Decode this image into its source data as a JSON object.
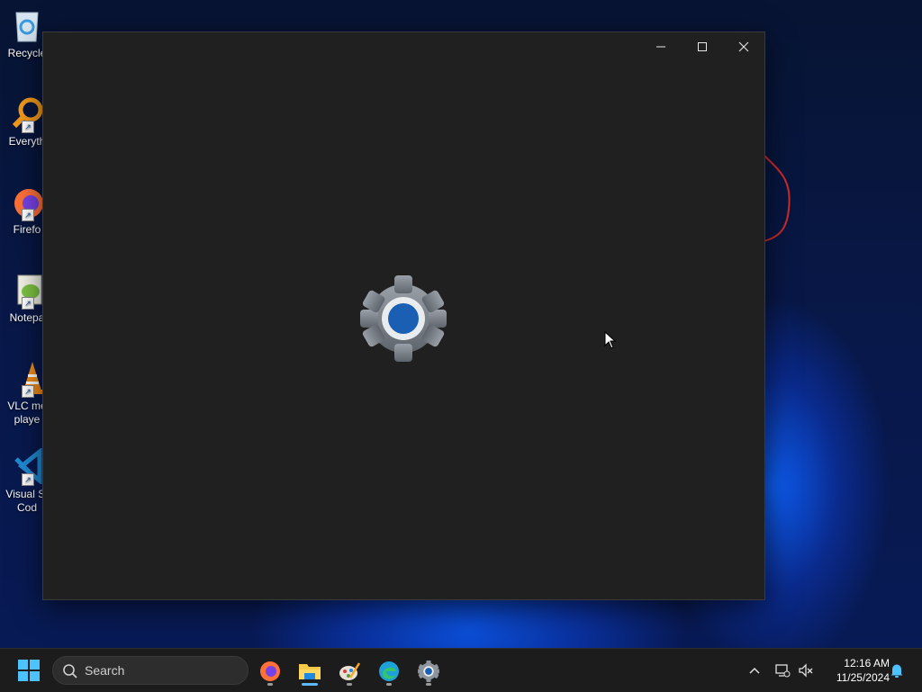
{
  "desktop": {
    "icons": [
      {
        "label": "Recycle",
        "icon": "recycle-bin-icon"
      },
      {
        "label": "Everyth",
        "icon": "everything-search-icon"
      },
      {
        "label": "Firefo",
        "icon": "firefox-icon"
      },
      {
        "label": "Notepa",
        "icon": "notepad-plus-plus-icon"
      },
      {
        "label": "VLC me\nplaye",
        "icon": "vlc-icon"
      },
      {
        "label": "Visual St\nCod",
        "icon": "vscode-icon"
      }
    ]
  },
  "window": {
    "app": "Settings",
    "splash_icon": "settings-gear-icon",
    "caption": {
      "minimize": "minimize-icon",
      "maximize": "maximize-icon",
      "close": "close-icon"
    }
  },
  "taskbar": {
    "search_placeholder": "Search",
    "apps": [
      {
        "name": "Firefox",
        "icon": "firefox-icon",
        "running": true
      },
      {
        "name": "File Explorer",
        "icon": "folder-icon",
        "running": true,
        "active": true
      },
      {
        "name": "Paint",
        "icon": "paint-icon",
        "running": true
      },
      {
        "name": "Microsoft Edge",
        "icon": "edge-icon",
        "running": true
      },
      {
        "name": "Settings",
        "icon": "settings-gear-icon",
        "running": true
      }
    ],
    "tray": {
      "time": "12:16 AM",
      "date": "11/25/2024"
    }
  },
  "colors": {
    "window_bg": "#202020",
    "taskbar_bg": "#1c1c1c",
    "accent": "#0078d4"
  }
}
